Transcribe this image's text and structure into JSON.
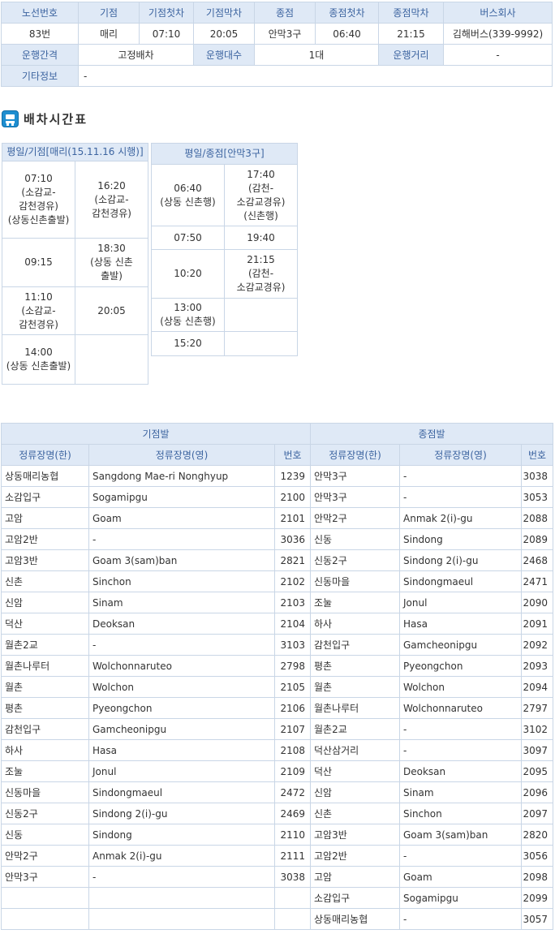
{
  "route_info": {
    "headers": {
      "route_no": "노선번호",
      "start": "기점",
      "start_first": "기점첫차",
      "start_last": "기점막차",
      "end": "종점",
      "end_first": "종점첫차",
      "end_last": "종점막차",
      "company": "버스회사"
    },
    "values": {
      "route_no": "83번",
      "start": "매리",
      "start_first": "07:10",
      "start_last": "20:05",
      "end": "안막3구",
      "end_first": "06:40",
      "end_last": "21:15",
      "company": "김해버스(339-9992)"
    },
    "interval_label": "운행간격",
    "interval_value": "고정배차",
    "vehicles_label": "운행대수",
    "vehicles_value": "1대",
    "distance_label": "운행거리",
    "distance_value": "-",
    "etc_label": "기타정보",
    "etc_value": "-"
  },
  "section_title": "배차시간표",
  "timetable_start": {
    "header": "평일/기점[매리(15.11.16 시행)]",
    "rows": [
      [
        "07:10\n(소감교-감천경유)\n(상동신촌출발)",
        "16:20\n(소감교- 감천경유)"
      ],
      [
        "09:15",
        "18:30\n(상동 신촌 출발)"
      ],
      [
        "11:10\n(소감교- 감천경유)",
        "20:05"
      ],
      [
        "14:00\n(상동 신촌출발)",
        ""
      ]
    ]
  },
  "timetable_end": {
    "header": "평일/종점[안막3구]",
    "rows": [
      [
        "06:40\n(상동 신촌행)",
        "17:40\n(감천-소감교경유)\n(신촌행)"
      ],
      [
        "07:50",
        "19:40"
      ],
      [
        "10:20",
        "21:15\n(감천-소감교경유)"
      ],
      [
        "13:00\n(상동 신촌행)",
        ""
      ],
      [
        "15:20",
        ""
      ]
    ]
  },
  "stops": {
    "start_group": "기점발",
    "end_group": "종점발",
    "col_kr": "정류장명(한)",
    "col_en": "정류장명(영)",
    "col_no": "번호",
    "start_rows": [
      [
        "상동매리농협",
        "Sangdong Mae-ri Nonghyup",
        "1239"
      ],
      [
        "소감입구",
        "Sogamipgu",
        "2100"
      ],
      [
        "고암",
        "Goam",
        "2101"
      ],
      [
        "고암2반",
        "-",
        "3036"
      ],
      [
        "고암3반",
        "Goam 3(sam)ban",
        "2821"
      ],
      [
        "신촌",
        "Sinchon",
        "2102"
      ],
      [
        "신암",
        "Sinam",
        "2103"
      ],
      [
        "덕산",
        "Deoksan",
        "2104"
      ],
      [
        "월촌2교",
        "-",
        "3103"
      ],
      [
        "월촌나루터",
        "Wolchonnaruteo",
        "2798"
      ],
      [
        "월촌",
        "Wolchon",
        "2105"
      ],
      [
        "평촌",
        "Pyeongchon",
        "2106"
      ],
      [
        "감천입구",
        "Gamcheonipgu",
        "2107"
      ],
      [
        "하사",
        "Hasa",
        "2108"
      ],
      [
        "조눌",
        "Jonul",
        "2109"
      ],
      [
        "신동마을",
        "Sindongmaeul",
        "2472"
      ],
      [
        "신동2구",
        "Sindong 2(i)-gu",
        "2469"
      ],
      [
        "신동",
        "Sindong",
        "2110"
      ],
      [
        "안막2구",
        "Anmak 2(i)-gu",
        "2111"
      ],
      [
        "안막3구",
        "-",
        "3038"
      ],
      [
        "",
        "",
        ""
      ],
      [
        "",
        "",
        ""
      ]
    ],
    "end_rows": [
      [
        "안막3구",
        "-",
        "3038"
      ],
      [
        "안막3구",
        "-",
        "3053"
      ],
      [
        "안막2구",
        "Anmak 2(i)-gu",
        "2088"
      ],
      [
        "신동",
        "Sindong",
        "2089"
      ],
      [
        "신동2구",
        "Sindong 2(i)-gu",
        "2468"
      ],
      [
        "신동마을",
        "Sindongmaeul",
        "2471"
      ],
      [
        "조눌",
        "Jonul",
        "2090"
      ],
      [
        "하사",
        "Hasa",
        "2091"
      ],
      [
        "감천입구",
        "Gamcheonipgu",
        "2092"
      ],
      [
        "평촌",
        "Pyeongchon",
        "2093"
      ],
      [
        "월촌",
        "Wolchon",
        "2094"
      ],
      [
        "월촌나루터",
        "Wolchonnaruteo",
        "2797"
      ],
      [
        "월촌2교",
        "-",
        "3102"
      ],
      [
        "덕산삼거리",
        "-",
        "3097"
      ],
      [
        "덕산",
        "Deoksan",
        "2095"
      ],
      [
        "신암",
        "Sinam",
        "2096"
      ],
      [
        "신촌",
        "Sinchon",
        "2097"
      ],
      [
        "고암3반",
        "Goam 3(sam)ban",
        "2820"
      ],
      [
        "고암2반",
        "-",
        "3056"
      ],
      [
        "고암",
        "Goam",
        "2098"
      ],
      [
        "소감입구",
        "Sogamipgu",
        "2099"
      ],
      [
        "상동매리농협",
        "-",
        "3057"
      ]
    ]
  }
}
